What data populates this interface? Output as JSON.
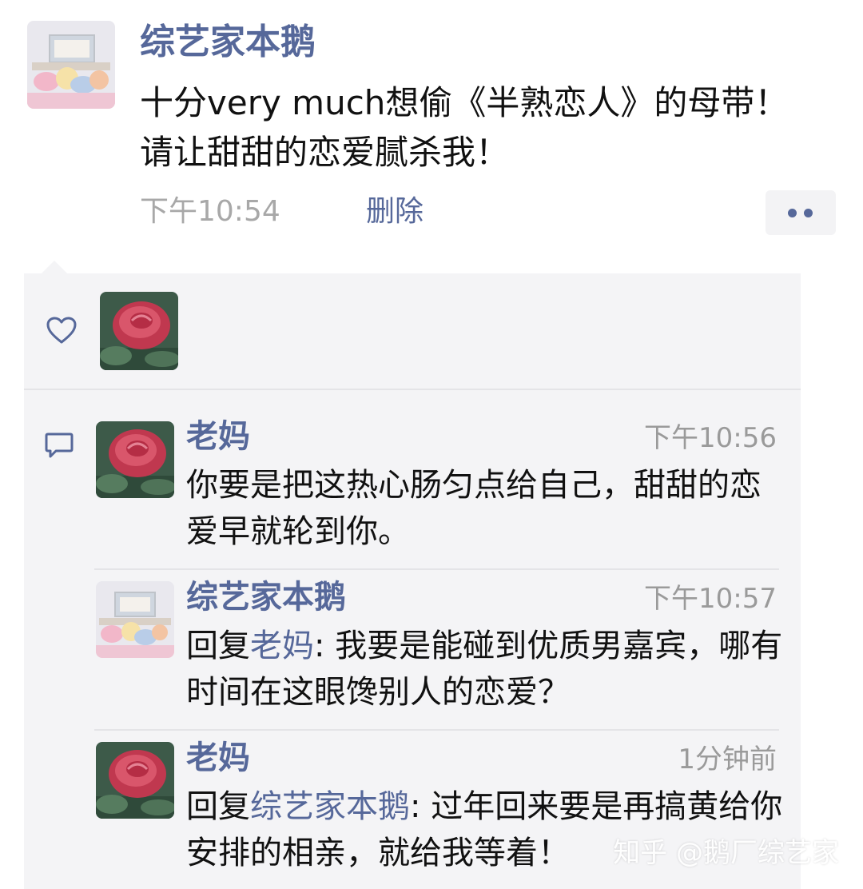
{
  "post": {
    "author": "综艺家本鹅",
    "text": "十分very much想偷《半熟恋人》的母带！请让甜甜的恋爱腻杀我！",
    "time": "下午10:54",
    "delete_label": "删除"
  },
  "likes": {
    "icon": "heart-outline-icon"
  },
  "comments": [
    {
      "author": "老妈",
      "time": "下午10:56",
      "text": "你要是把这热心肠匀点给自己，甜甜的恋爱早就轮到你。"
    },
    {
      "author": "综艺家本鹅",
      "time": "下午10:57",
      "reply_prefix": "回复",
      "reply_to": "老妈",
      "text": ": 我要是能碰到优质男嘉宾，哪有时间在这眼馋别人的恋爱？"
    },
    {
      "author": "老妈",
      "time": "1分钟前",
      "reply_prefix": "回复",
      "reply_to": "综艺家本鹅",
      "text": ": 过年回来要是再搞黄给你安排的相亲，就给我等着！"
    }
  ],
  "watermark": "知乎 @鹅厂综艺家",
  "colors": {
    "name_blue": "#56689a",
    "panel_bg": "#f4f4f6",
    "time_gray": "#a8a8a8"
  }
}
